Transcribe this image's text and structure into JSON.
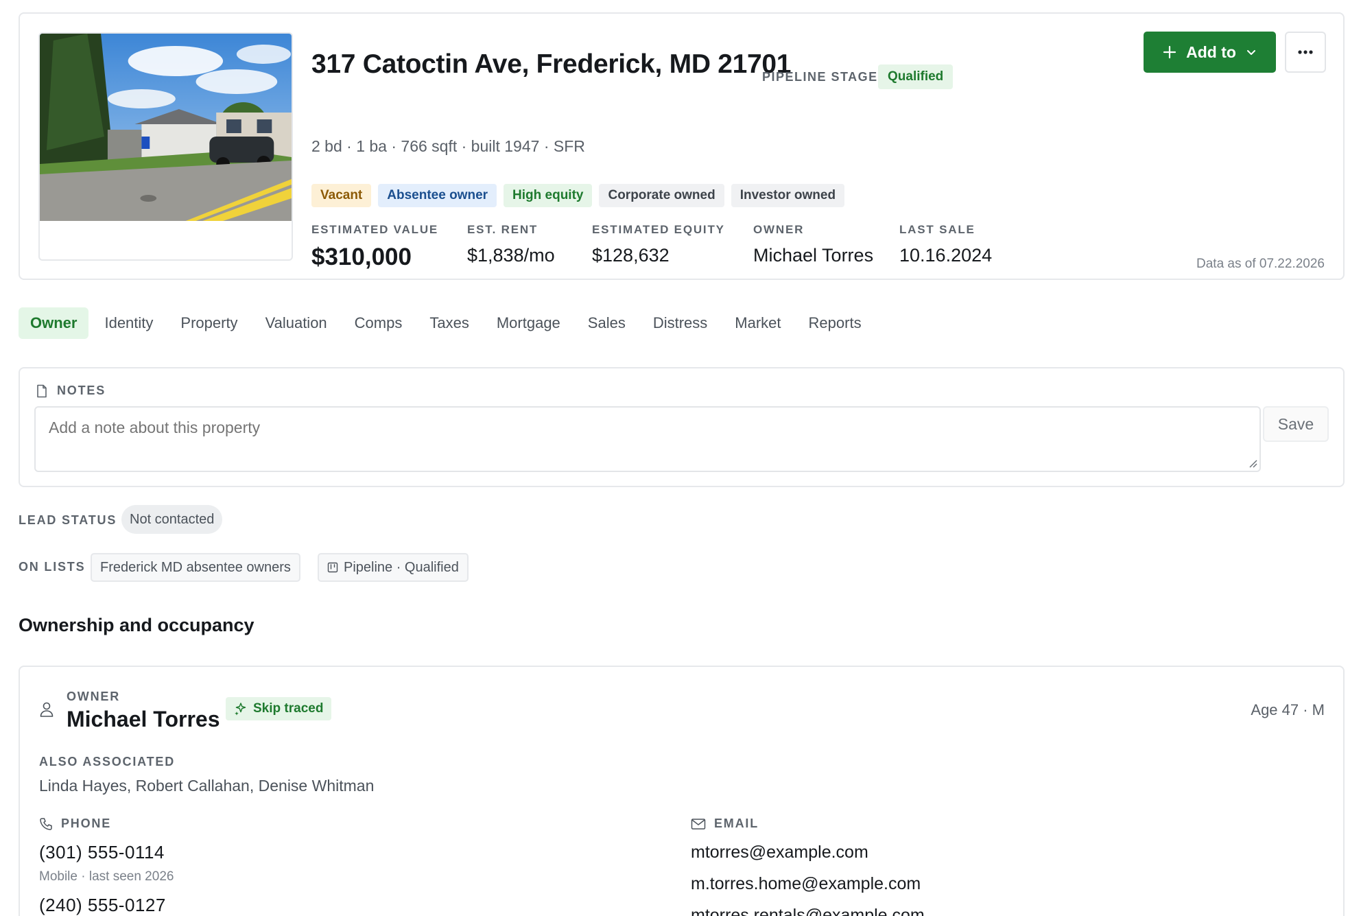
{
  "property": {
    "address": "317 Catoctin Ave, Frederick, MD 21701",
    "pipeline_stage_label": "PIPELINE STAGE",
    "pipeline_stage": "Qualified",
    "facts": "2 bd · 1 ba · 766 sqft · built 1947 · SFR",
    "tags": [
      "Vacant",
      "Absentee owner",
      "High equity",
      "Corporate owned",
      "Investor owned"
    ],
    "metrics": [
      {
        "label": "ESTIMATED VALUE",
        "value": "$310,000"
      },
      {
        "label": "EST. RENT",
        "value": "$1,838/mo"
      },
      {
        "label": "ESTIMATED EQUITY",
        "value": "$128,632"
      },
      {
        "label": "OWNER",
        "value": "Michael Torres"
      },
      {
        "label": "LAST SALE",
        "value": "10.16.2024"
      }
    ],
    "data_as_of": "Data as of 07.22.2026"
  },
  "actions": {
    "add_to_label": "Add to",
    "more_icon": "ellipsis-icon"
  },
  "tabs": [
    "Owner",
    "Identity",
    "Property",
    "Valuation",
    "Comps",
    "Taxes",
    "Mortgage",
    "Sales",
    "Distress",
    "Market",
    "Reports"
  ],
  "active_tab": "Owner",
  "notes": {
    "label": "NOTES",
    "placeholder": "Add a note about this property",
    "save_label": "Save"
  },
  "lead_status": {
    "label": "LEAD STATUS",
    "value": "Not contacted"
  },
  "on_lists": {
    "label": "ON LISTS",
    "items": [
      "Frederick MD absentee owners",
      "Pipeline · Qualified"
    ]
  },
  "section_title": "Ownership and occupancy",
  "owner": {
    "label": "OWNER",
    "name": "Michael Torres",
    "badge": "Skip traced",
    "age": "Age 47 · M",
    "also_associated_label": "ALSO ASSOCIATED",
    "also_associated": "Linda Hayes, Robert Callahan, Denise Whitman",
    "phone_label": "PHONE",
    "phones": [
      {
        "number": "(301) 555-0114",
        "detail": "Mobile · last seen 2026"
      },
      {
        "number": "(240) 555-0127",
        "detail": ""
      }
    ],
    "email_label": "EMAIL",
    "emails": [
      "mtorres@example.com",
      "m.torres.home@example.com",
      "mtorres.rentals@example.com"
    ]
  },
  "colors": {
    "accent_green": "#1e7f34",
    "badge_green_bg": "#e6f5e8",
    "badge_green_fg": "#1e7a2e"
  }
}
